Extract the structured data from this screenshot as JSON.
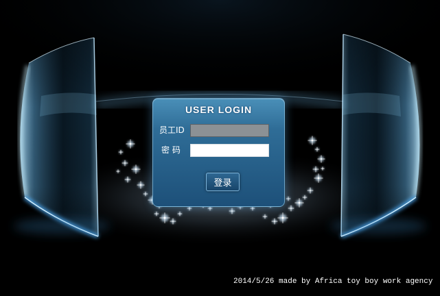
{
  "login": {
    "title": "USER LOGIN",
    "employee_id": {
      "label": "员工ID",
      "value": ""
    },
    "password": {
      "label": "密 码",
      "value": ""
    },
    "submit_label": "登录"
  },
  "footer": {
    "text": "2014/5/26 made by Africa toy boy work agency"
  },
  "colors": {
    "background": "#000000",
    "box_top": "#4a8fb8",
    "box_mid": "#2f6d97",
    "box_bottom": "#1d5079",
    "input_gray": "#8c9195",
    "input_white": "#ffffff",
    "button_bg": "#18456a",
    "button_border": "#7fb6dc",
    "glass_accent": "#6fb8e6"
  }
}
